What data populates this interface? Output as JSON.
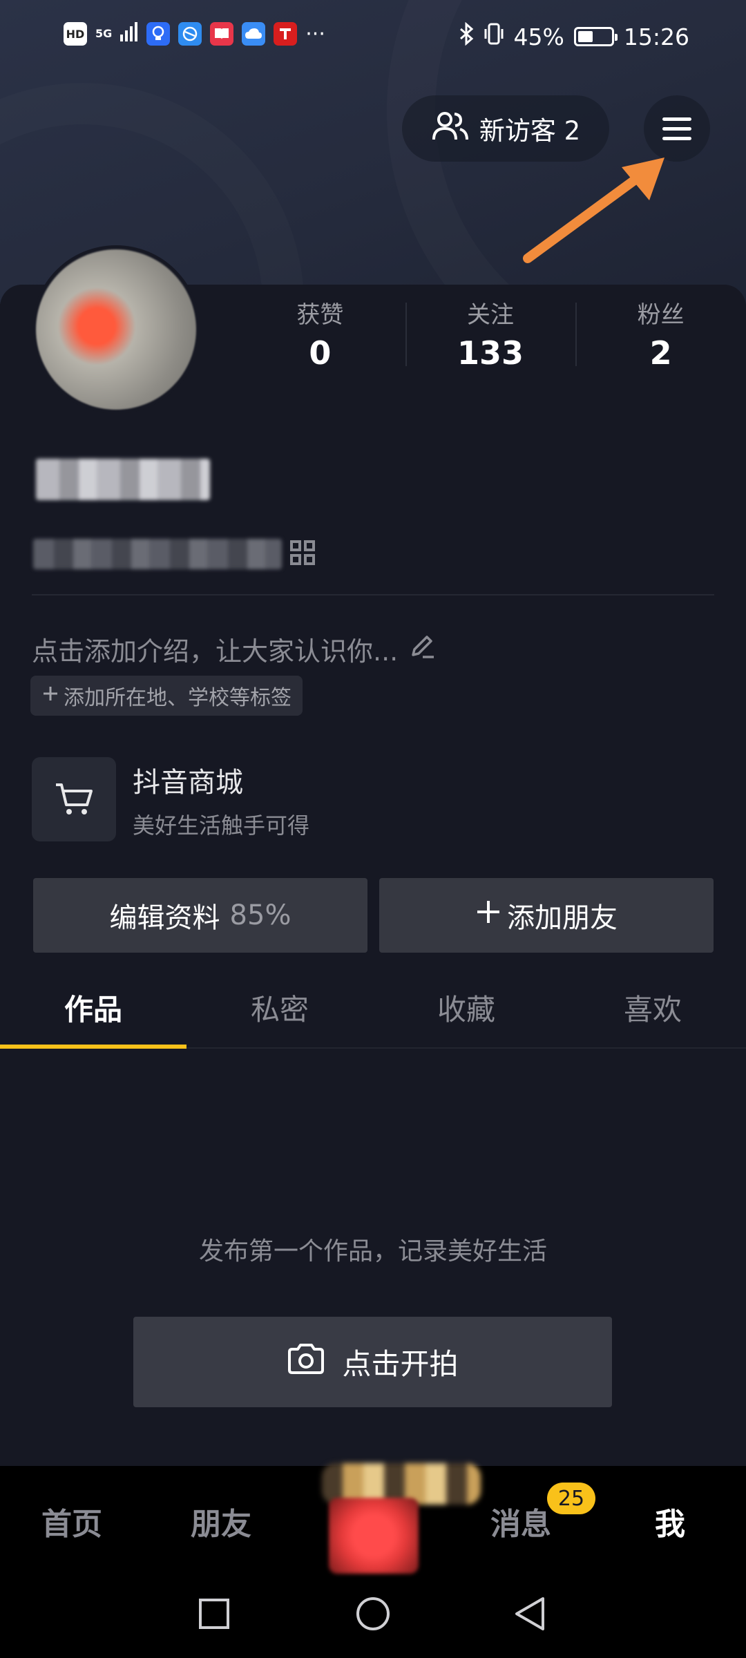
{
  "status_bar": {
    "left_badges": [
      "HD",
      "5G"
    ],
    "bluetooth_icon": "bluetooth-icon",
    "vibrate_icon": "vibrate-icon",
    "battery_percent": "45%",
    "battery_level": 0.45,
    "time": "15:26",
    "more_indicator": "···"
  },
  "header": {
    "visitors_label": "新访客 2",
    "visitors_icon": "users-icon",
    "menu_icon": "hamburger-menu-icon",
    "annotation_arrow_color": "#f28c3c"
  },
  "stats": [
    {
      "label": "获赞",
      "value": "0"
    },
    {
      "label": "关注",
      "value": "133"
    },
    {
      "label": "粉丝",
      "value": "2"
    }
  ],
  "profile": {
    "bio_placeholder": "点击添加介绍，让大家认识你...",
    "tag_button": "添加所在地、学校等标签"
  },
  "shop": {
    "title": "抖音商城",
    "subtitle": "美好生活触手可得"
  },
  "actions": {
    "edit_label": "编辑资料",
    "edit_percent": "85%",
    "add_friend_label": "添加朋友"
  },
  "tabs": [
    "作品",
    "私密",
    "收藏",
    "喜欢"
  ],
  "empty_state": {
    "message": "发布第一个作品，记录美好生活",
    "shoot_button": "点击开拍"
  },
  "bottom_nav": {
    "home": "首页",
    "friends": "朋友",
    "messages": "消息",
    "messages_badge": "25",
    "me": "我"
  },
  "colors": {
    "background": "#161823",
    "accent": "#f9c11a",
    "button": "#363841",
    "muted_text": "#8b8c94"
  }
}
